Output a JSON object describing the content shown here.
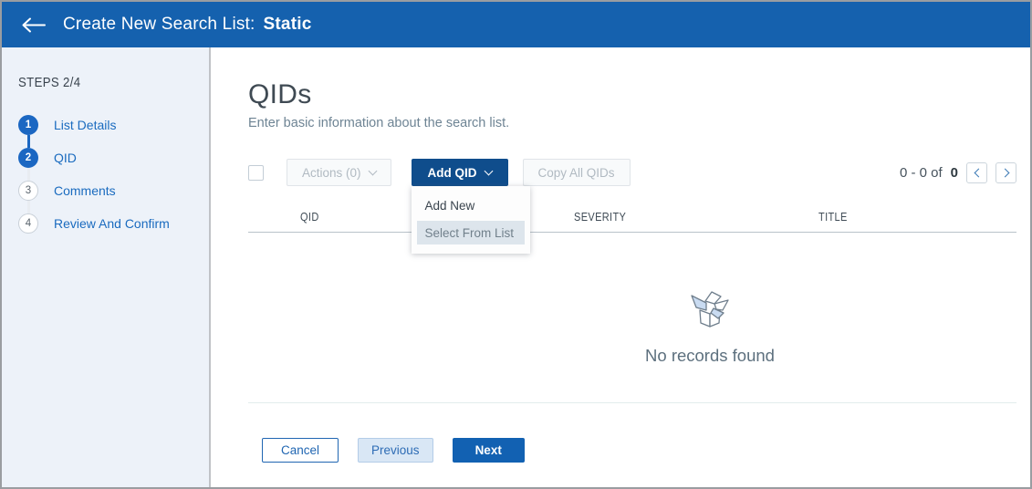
{
  "header": {
    "back_icon": "arrow-left",
    "title_prefix": "Create New Search List:",
    "title_emphasis": "Static"
  },
  "sidebar": {
    "steps_label": "STEPS 2/4",
    "steps": [
      {
        "number": "1",
        "label": "List Details",
        "state": "completed"
      },
      {
        "number": "2",
        "label": "QID",
        "state": "active"
      },
      {
        "number": "3",
        "label": "Comments",
        "state": "upcoming"
      },
      {
        "number": "4",
        "label": "Review And Confirm",
        "state": "upcoming"
      }
    ]
  },
  "main": {
    "title": "QIDs",
    "subtitle": "Enter basic information about the search list.",
    "toolbar": {
      "select_all_checkbox": "unchecked",
      "actions_label": "Actions (0)",
      "add_qid_label": "Add QID",
      "copy_all_label": "Copy All QIDs"
    },
    "add_qid_dropdown": {
      "open": true,
      "items": [
        {
          "label": "Add New",
          "highlighted": false
        },
        {
          "label": "Select From List",
          "highlighted": true
        }
      ]
    },
    "pagination": {
      "range_text": "0 - 0 of",
      "total": "0",
      "prev_icon": "chevron-left",
      "next_icon": "chevron-right"
    },
    "table": {
      "columns": [
        "QID",
        "SEVERITY",
        "TITLE"
      ],
      "rows": []
    },
    "empty_state": {
      "icon": "empty-box",
      "message": "No records found"
    },
    "footer": {
      "cancel_label": "Cancel",
      "previous_label": "Previous",
      "next_label": "Next"
    }
  },
  "colors": {
    "header_blue": "#1561ae",
    "primary_dark": "#0f4d8c",
    "step_blue": "#1b67c2",
    "link_blue": "#1a6bbf",
    "sidebar_bg": "#edf2f9",
    "highlight": "#dde5ec",
    "action_blue": "#2066b2",
    "next_blue": "#1261b2",
    "frame_border": "#9a9da1"
  }
}
